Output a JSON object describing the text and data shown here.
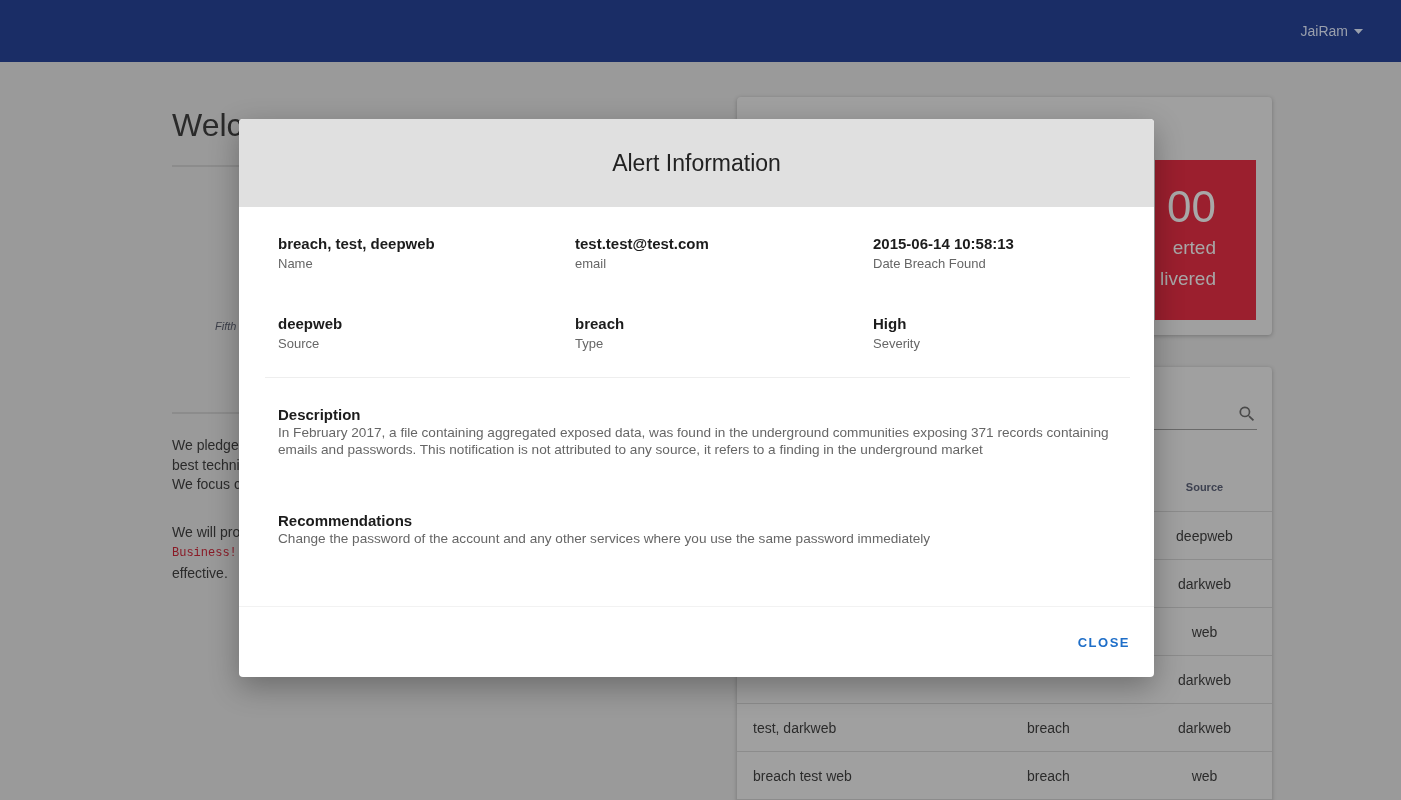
{
  "user_menu": {
    "label": "JaiRam"
  },
  "welcome": {
    "heading": "Welc",
    "caption": "Fifth",
    "paragraph_1": [
      "We pledge",
      "best techni",
      "We focus c"
    ],
    "paragraph_2": [
      {
        "kind": "plain",
        "text": "We will pro"
      },
      {
        "kind": "code",
        "text": "Business!"
      },
      {
        "kind": "plain",
        "text": "effective."
      }
    ]
  },
  "summary": {
    "count": "00",
    "lines": [
      "erted",
      "livered"
    ]
  },
  "alerts_table": {
    "columns": [
      "Source"
    ],
    "rows": [
      {
        "source": "deepweb"
      },
      {
        "source": "darkweb"
      },
      {
        "source": "web"
      },
      {
        "source": "darkweb"
      },
      {
        "name": "test, darkweb",
        "type": "breach",
        "source": "darkweb"
      },
      {
        "name": "breach test web",
        "type": "breach",
        "source": "web"
      }
    ]
  },
  "dialog": {
    "title": "Alert Information",
    "fields": [
      {
        "value": "breach, test, deepweb",
        "label": "Name"
      },
      {
        "value": "test.test@test.com",
        "label": "email"
      },
      {
        "value": "2015-06-14 10:58:13",
        "label": "Date Breach Found"
      },
      {
        "value": "deepweb",
        "label": "Source"
      },
      {
        "value": "breach",
        "label": "Type"
      },
      {
        "value": "High",
        "label": "Severity"
      }
    ],
    "sections": [
      {
        "heading": "Description",
        "text": "In February 2017, a file containing aggregated exposed data, was found in the underground communities exposing 371 records containing emails and passwords. This notification is not attributed to any source, it refers to a finding in the underground market"
      },
      {
        "heading": "Recommendations",
        "text": "Change the password of the account and any other services where you use the same password immediately"
      }
    ],
    "close_button": "CLOSE"
  }
}
